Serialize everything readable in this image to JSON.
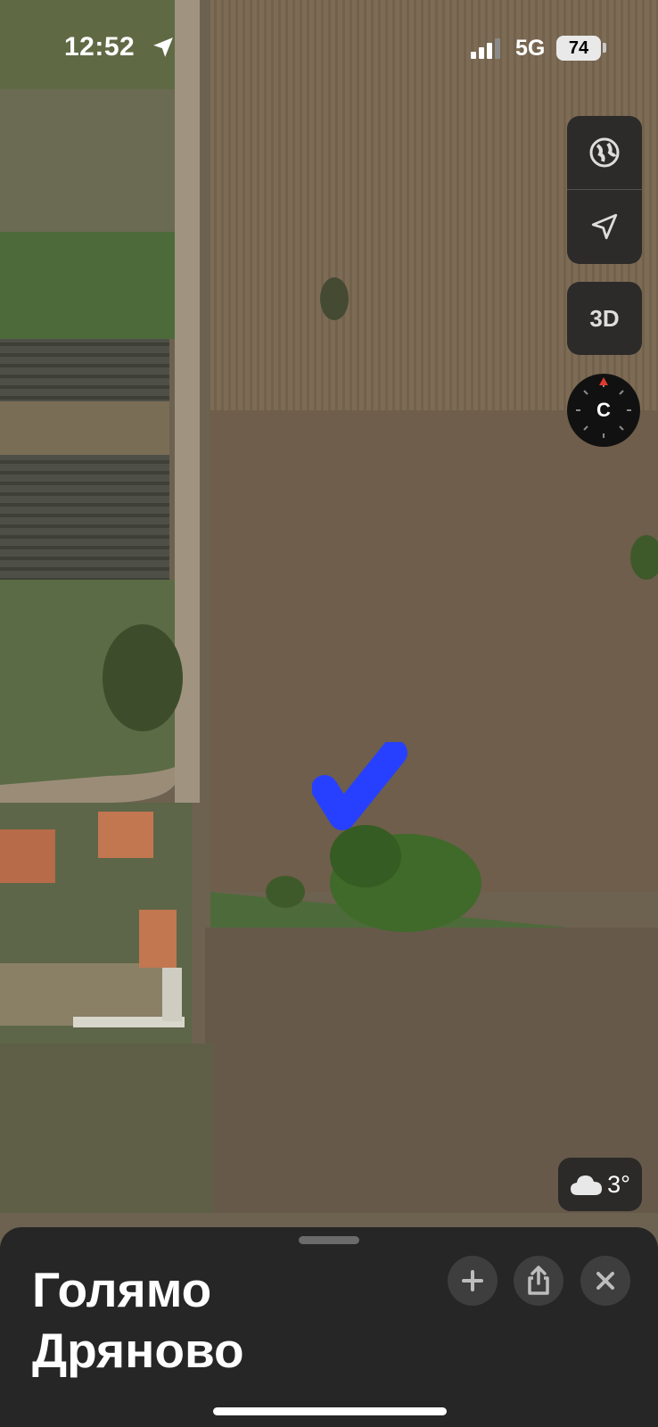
{
  "status_bar": {
    "time": "12:52",
    "network": "5G",
    "battery": "74"
  },
  "map_controls": {
    "map_mode_icon": "globe-icon",
    "location_icon": "location-arrow-icon",
    "three_d_label": "3D",
    "compass_letter": "C",
    "compass_accent": "#e03a2f"
  },
  "weather": {
    "icon": "cloud-icon",
    "temperature": "3°"
  },
  "place_card": {
    "title": "Голямо Дряново",
    "actions": [
      "plus-icon",
      "share-icon",
      "close-icon"
    ]
  },
  "marker": {
    "icon": "checkmark-icon",
    "color": "#2740ff"
  }
}
